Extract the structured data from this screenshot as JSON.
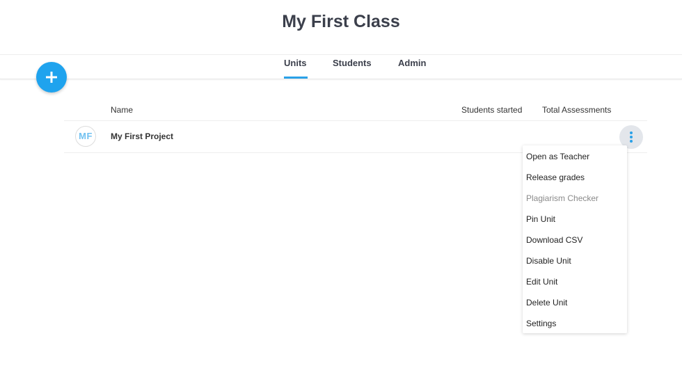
{
  "page": {
    "title": "My First Class"
  },
  "tabs": [
    {
      "label": "Units",
      "active": true
    },
    {
      "label": "Students",
      "active": false
    },
    {
      "label": "Admin",
      "active": false
    }
  ],
  "add_button": {
    "icon": "plus-icon"
  },
  "table": {
    "columns": [
      "Name",
      "Students started",
      "Total Assessments"
    ],
    "rows": [
      {
        "initials": "MF",
        "name": "My First Project",
        "students_started": "",
        "total_assessments": ""
      }
    ]
  },
  "row_menu": {
    "icon": "kebab-menu-icon",
    "items": [
      {
        "label": "Open as Teacher",
        "disabled": false
      },
      {
        "label": "Release grades",
        "disabled": false
      },
      {
        "label": "Plagiarism Checker",
        "disabled": true
      },
      {
        "label": "Pin Unit",
        "disabled": false
      },
      {
        "label": "Download CSV",
        "disabled": false
      },
      {
        "label": "Disable Unit",
        "disabled": false
      },
      {
        "label": "Edit Unit",
        "disabled": false
      },
      {
        "label": "Delete Unit",
        "disabled": false
      },
      {
        "label": "Settings",
        "disabled": false
      }
    ]
  },
  "colors": {
    "accent": "#1fa3ee",
    "avatar_text": "#71c1f0",
    "disabled_text": "#8a8a8a"
  }
}
